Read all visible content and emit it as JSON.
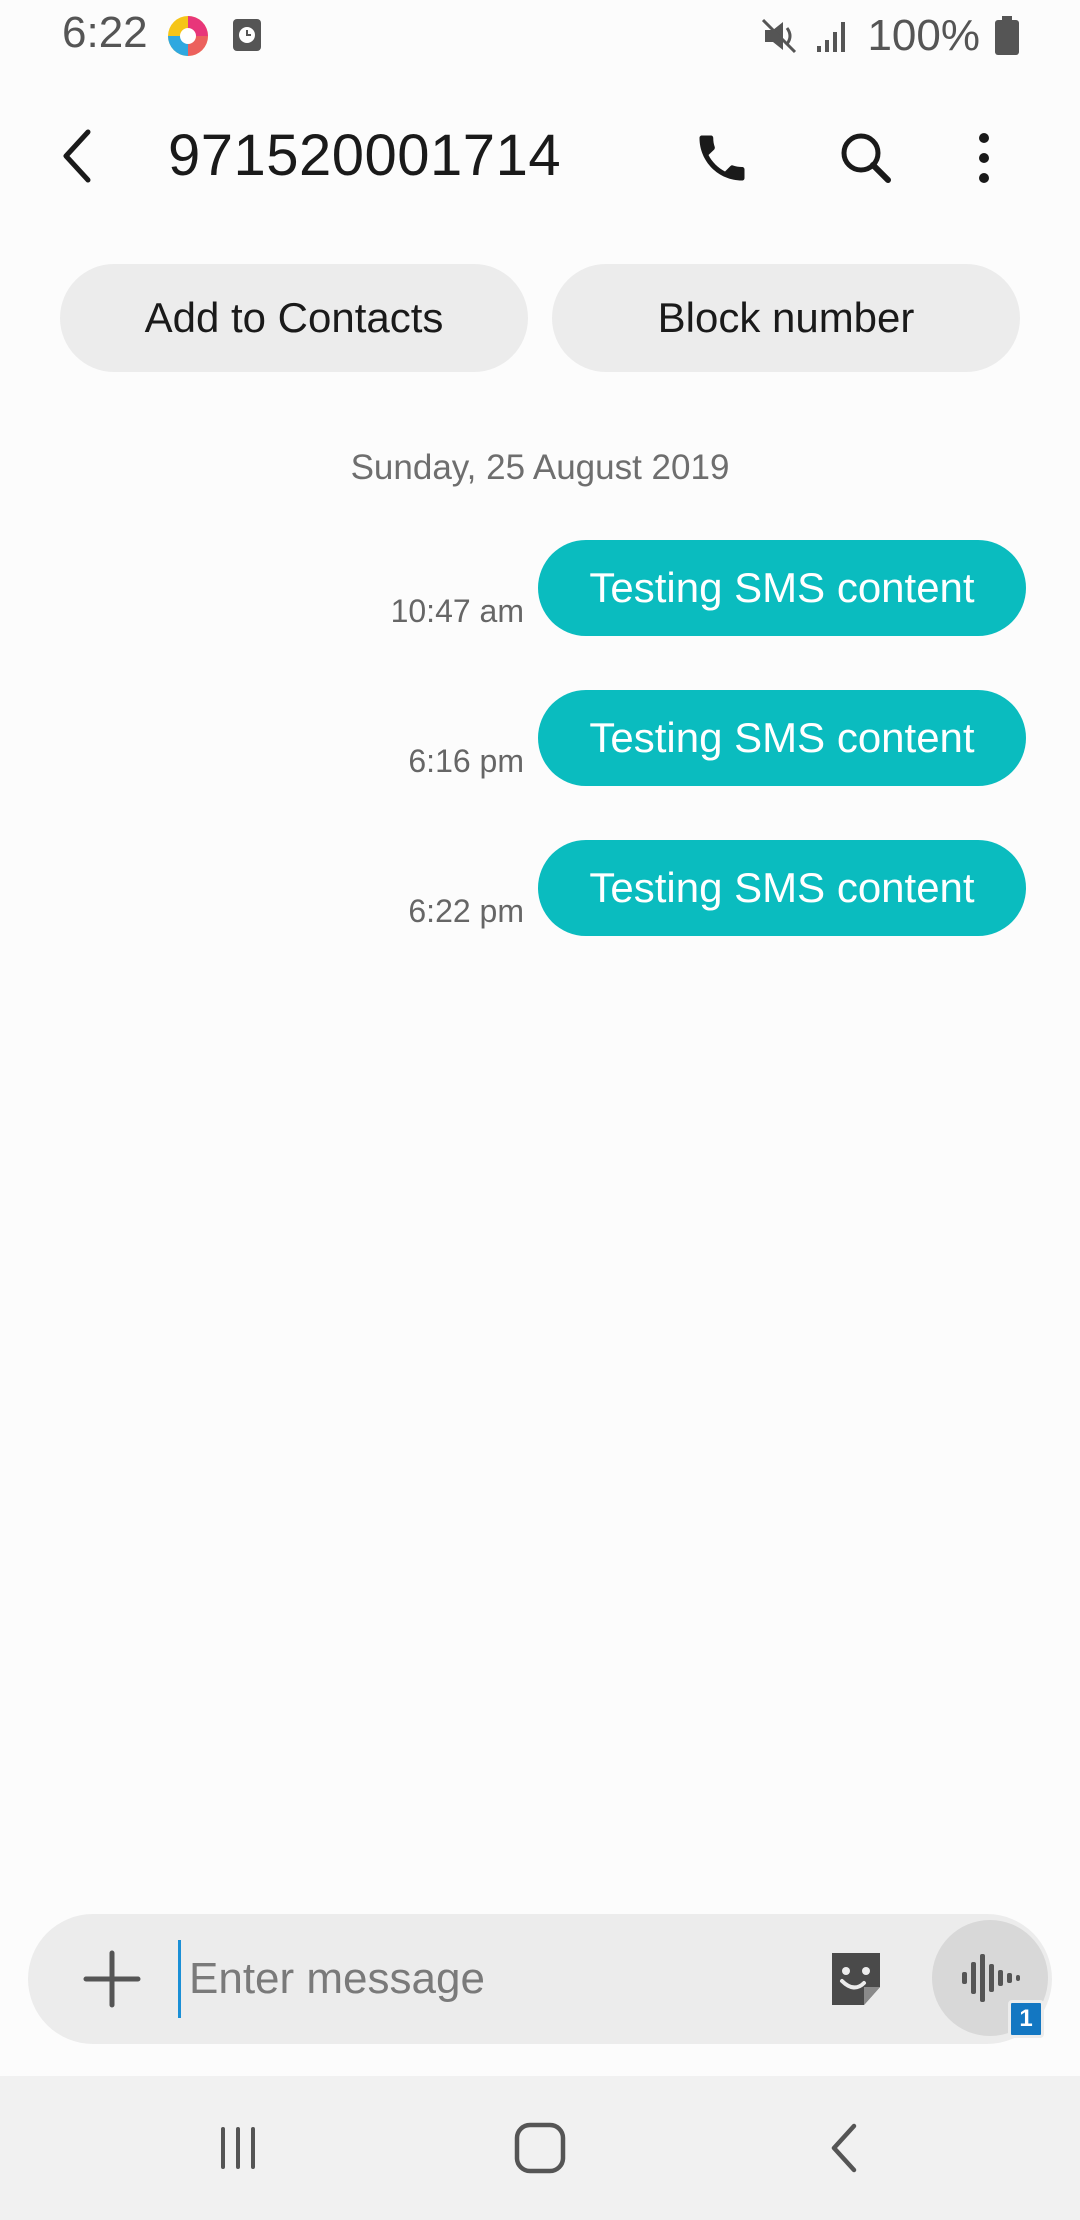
{
  "status_bar": {
    "time": "6:22",
    "battery": "100%",
    "icons": [
      "app-notification-icon",
      "clock-app-icon",
      "mute-icon",
      "signal-icon",
      "battery-icon"
    ]
  },
  "header": {
    "title": "971520001714",
    "icons": [
      "back-arrow-icon",
      "phone-icon",
      "search-icon",
      "more-vert-icon"
    ]
  },
  "actions": {
    "add_contact": "Add to Contacts",
    "block_number": "Block number"
  },
  "conversation": {
    "date": "Sunday, 25 August 2019",
    "messages": [
      {
        "text": "Testing SMS content",
        "time": "10:47 am"
      },
      {
        "text": "Testing SMS content",
        "time": "6:16 pm"
      },
      {
        "text": "Testing SMS content",
        "time": "6:22 pm"
      }
    ]
  },
  "composer": {
    "placeholder": "Enter message",
    "sim_badge": "1",
    "icons": [
      "plus-icon",
      "sticker-icon",
      "voice-record-icon"
    ]
  },
  "nav_bar": {
    "icons": [
      "recents-icon",
      "home-icon",
      "nav-back-icon"
    ]
  },
  "colors": {
    "bubble": "#0abcbf",
    "background": "#fcfcfc",
    "chip": "#ececec",
    "sim_badge": "#1377c2"
  }
}
